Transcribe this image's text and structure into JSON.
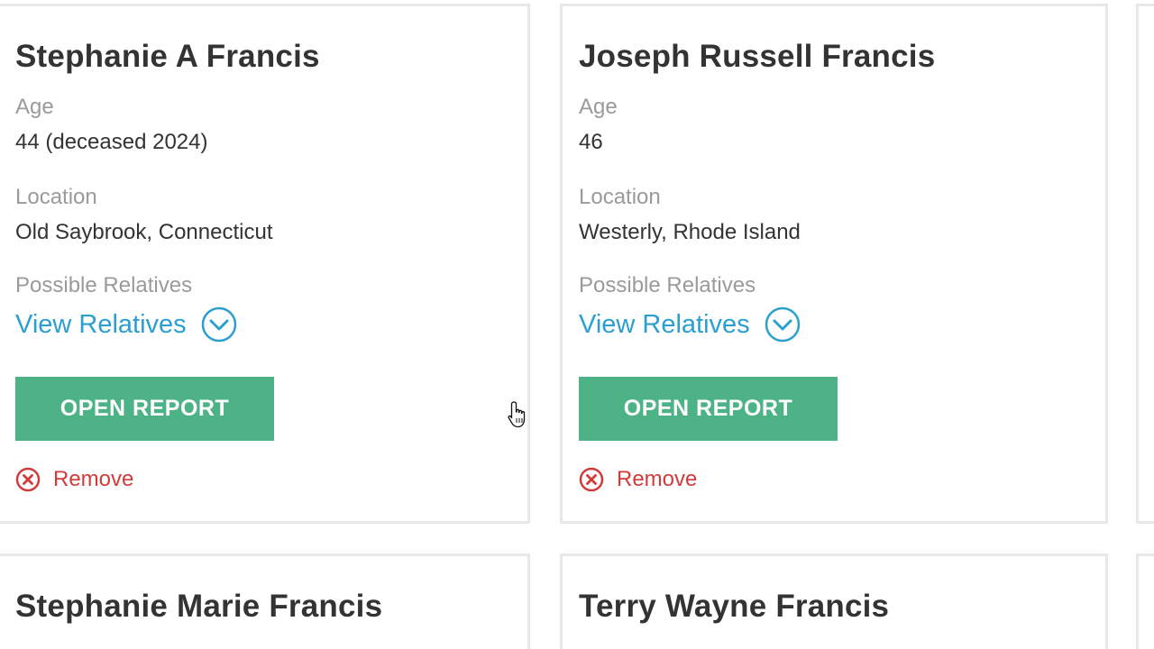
{
  "results": [
    {
      "name": "Stephanie A Francis",
      "age_label": "Age",
      "age_value": "44 (deceased 2024)",
      "location_label": "Location",
      "location_value": "Old Saybrook, Connecticut",
      "relatives_label": "Possible Relatives",
      "view_relatives": "View Relatives",
      "open_report": "OPEN REPORT",
      "remove": "Remove"
    },
    {
      "name": "Joseph Russell Francis",
      "age_label": "Age",
      "age_value": "46",
      "location_label": "Location",
      "location_value": "Westerly, Rhode Island",
      "relatives_label": "Possible Relatives",
      "view_relatives": "View Relatives",
      "open_report": "OPEN REPORT",
      "remove": "Remove"
    },
    {
      "name": "Stephanie Marie Francis"
    },
    {
      "name": "Terry Wayne Francis"
    }
  ],
  "colors": {
    "accent_button": "#4db286",
    "link": "#2a9fd0",
    "remove": "#d33a3a",
    "label": "#9a9a9a",
    "text": "#333333",
    "card_border": "#e8e8e8"
  },
  "icons": {
    "view_relatives": "chevron-down-circle-icon",
    "remove": "x-circle-icon",
    "pointer": "hand-pointer-cursor-icon"
  }
}
